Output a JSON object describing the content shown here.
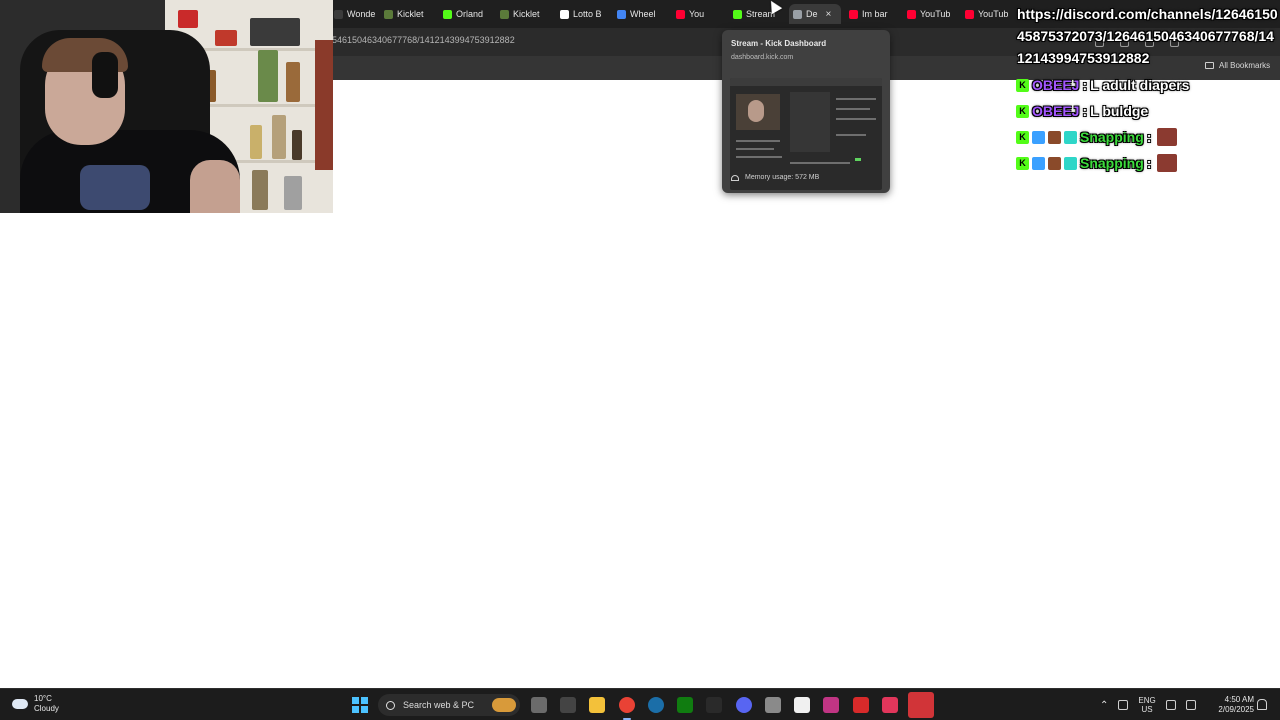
{
  "tabs": [
    {
      "label": "Wonde",
      "favicon_color": "#3b3b3b"
    },
    {
      "label": "Kicklet",
      "favicon_color": "#5b7a3a"
    },
    {
      "label": "Orland",
      "favicon_color": "#53fc18"
    },
    {
      "label": "Kicklet",
      "favicon_color": "#5b7a3a"
    },
    {
      "label": "Lotto B",
      "favicon_color": "#ffffff"
    },
    {
      "label": "Wheel",
      "favicon_color": "#4285f4"
    },
    {
      "label": "You",
      "favicon_color": "#ff0033"
    },
    {
      "label": "Stream",
      "favicon_color": "#53fc18"
    },
    {
      "label": "De",
      "favicon_color": "#9aa0a6",
      "active": true
    },
    {
      "label": "Im bar",
      "favicon_color": "#ff0033"
    },
    {
      "label": "YouTub",
      "favicon_color": "#ff0033"
    },
    {
      "label": "YouTub",
      "favicon_color": "#ff0033"
    }
  ],
  "address_bar": {
    "url_fragment": "54615046340677768/1412143994753912882"
  },
  "bookmarks_bar": {
    "all_bookmarks": "All Bookmarks"
  },
  "tab_preview": {
    "title": "Stream - Kick Dashboard",
    "domain": "dashboard.kick.com",
    "memory": "Memory usage: 572 MB"
  },
  "overlay": {
    "url_text": "https://discord.com/channels/1264615045875372073/1264615046340677768/1412143994753912882"
  },
  "chat": [
    {
      "badges": [
        {
          "color": "#53fc18",
          "glyph": "K"
        }
      ],
      "user": "OBEEJ",
      "user_color": "#a356ff",
      "separator": ":",
      "text": "L adult diapers",
      "emote": false
    },
    {
      "badges": [
        {
          "color": "#53fc18",
          "glyph": "K"
        }
      ],
      "user": "OBEEJ",
      "user_color": "#a356ff",
      "separator": ":",
      "text": "L buldge",
      "emote": false
    },
    {
      "badges": [
        {
          "color": "#53fc18",
          "glyph": "K"
        },
        {
          "color": "#3aa0ff",
          "glyph": ""
        },
        {
          "color": "#8a4a2a",
          "glyph": ""
        },
        {
          "color": "#2ed6c8",
          "glyph": ""
        }
      ],
      "user": "Snapping",
      "user_color": "#3ddc3d",
      "separator": ":",
      "text": "",
      "emote": true
    },
    {
      "badges": [
        {
          "color": "#53fc18",
          "glyph": "K"
        },
        {
          "color": "#3aa0ff",
          "glyph": ""
        },
        {
          "color": "#8a4a2a",
          "glyph": ""
        },
        {
          "color": "#2ed6c8",
          "glyph": ""
        }
      ],
      "user": "Snapping",
      "user_color": "#3ddc3d",
      "separator": ":",
      "text": "",
      "emote": true
    }
  ],
  "taskbar": {
    "weather_temp": "10°C",
    "weather_desc": "Cloudy",
    "search_label": "Search web & PC",
    "lang_top": "ENG",
    "lang_bottom": "US",
    "time": "4:50 AM",
    "date": "2/09/2025",
    "icons": [
      {
        "name": "task-view-icon",
        "color": "#6b6b6b"
      },
      {
        "name": "copilot-icon",
        "color": "#444"
      },
      {
        "name": "file-explorer-icon",
        "color": "#f3c13a"
      },
      {
        "name": "chrome-icon",
        "color": "#e94235"
      },
      {
        "name": "steam-icon",
        "color": "#1b6ea8"
      },
      {
        "name": "xbox-icon",
        "color": "#107c10"
      },
      {
        "name": "epic-games-icon",
        "color": "#2a2a2a"
      },
      {
        "name": "discord-icon",
        "color": "#5865f2"
      },
      {
        "name": "settings-icon",
        "color": "#8a8a8a"
      },
      {
        "name": "store-icon",
        "color": "#f0f0f0"
      },
      {
        "name": "instagram-icon",
        "color": "#c13584"
      },
      {
        "name": "bts-icon",
        "color": "#d82a2a"
      },
      {
        "name": "audio-app-icon",
        "color": "#e2365b"
      }
    ]
  }
}
